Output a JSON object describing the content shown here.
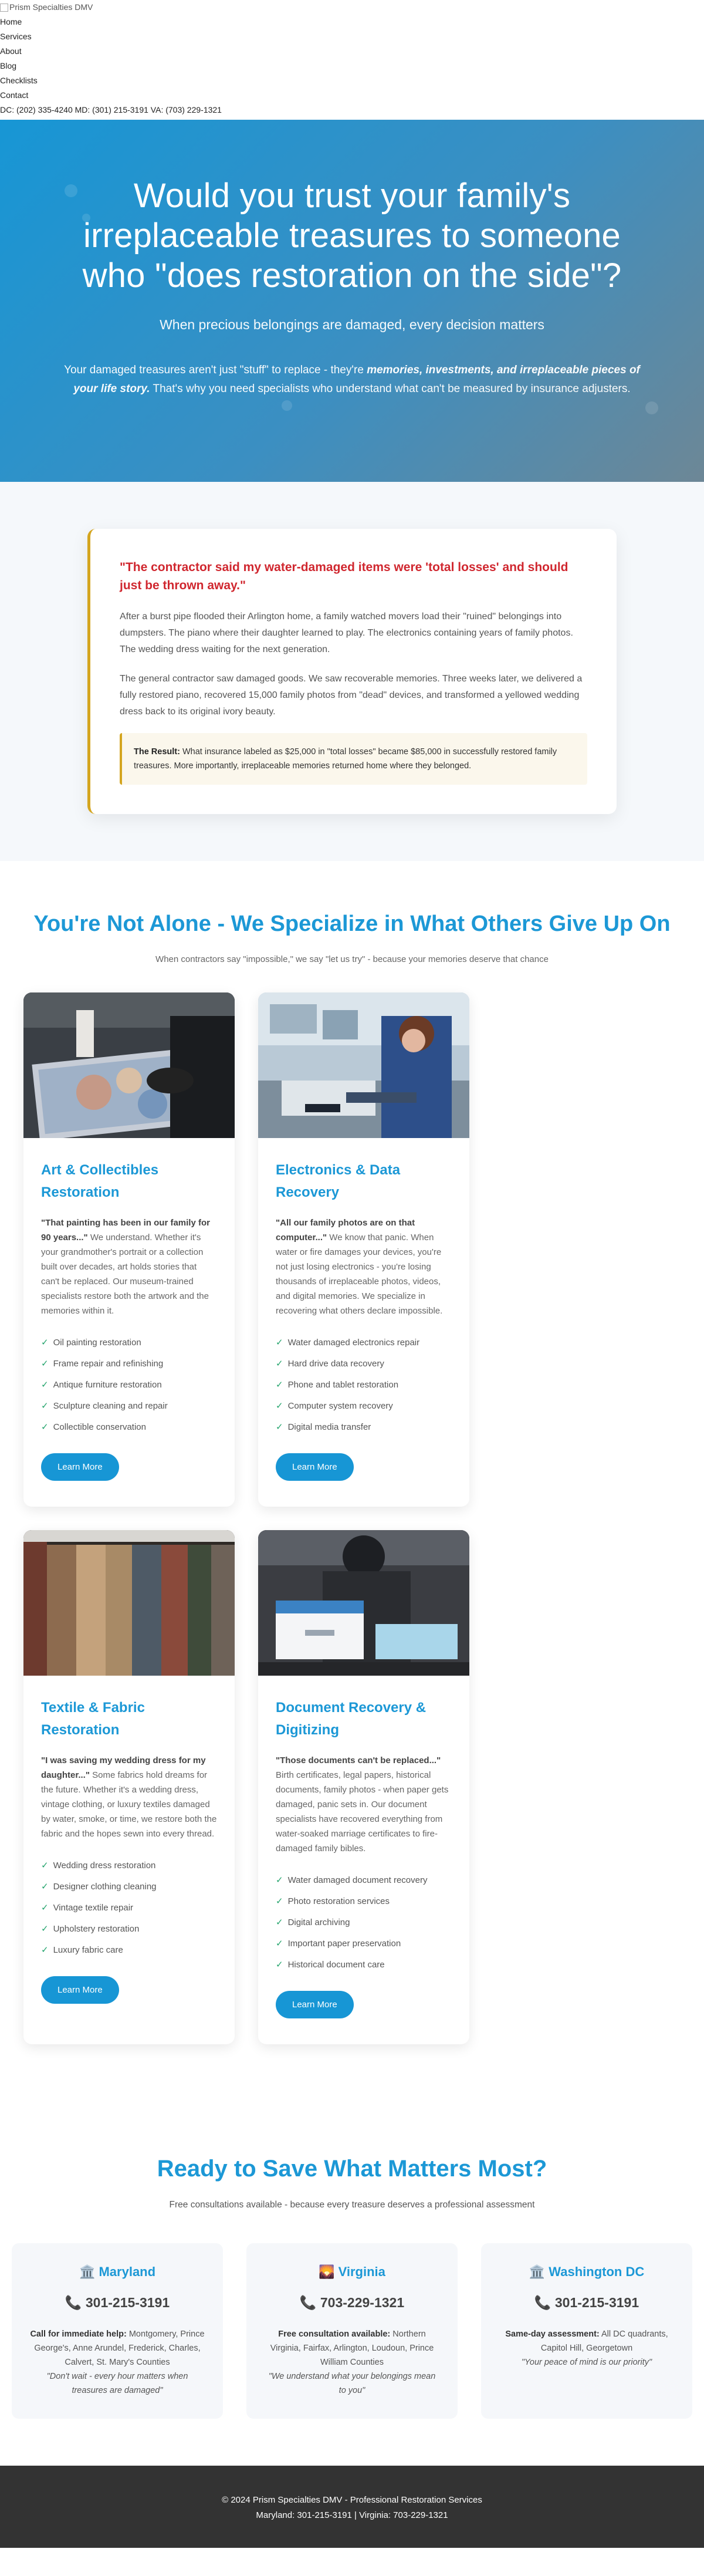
{
  "nav": {
    "logo_alt": "Prism Specialties DMV",
    "links": [
      "Home",
      "Services",
      "About",
      "Blog",
      "Checklists",
      "Contact"
    ],
    "contact_line": "DC: (202) 335-4240 MD: (301) 215-3191 VA: (703) 229-1321"
  },
  "hero": {
    "title": "Would you trust your family's irreplaceable treasures to someone who \"does restoration on the side\"?",
    "subtitle": "When precious belongings are damaged, every decision matters",
    "desc_before": "Your damaged treasures aren't just \"stuff\" to replace - they're ",
    "desc_bold": "memories, investments, and irreplaceable pieces of your life story.",
    "desc_after": " That's why you need specialists who understand what can't be measured by insurance adjusters."
  },
  "story": {
    "quote": "\"The contractor said my water-damaged items were 'total losses' and should just be thrown away.\"",
    "p1": "After a burst pipe flooded their Arlington home, a family watched movers load their \"ruined\" belongings into dumpsters. The piano where their daughter learned to play. The electronics containing years of family photos. The wedding dress waiting for the next generation.",
    "p2": "The general contractor saw damaged goods. We saw recoverable memories. Three weeks later, we delivered a fully restored piano, recovered 15,000 family photos from \"dead\" devices, and transformed a yellowed wedding dress back to its original ivory beauty.",
    "result_label": "The Result:",
    "result_text": " What insurance labeled as $25,000 in \"total losses\" became $85,000 in successfully restored family treasures. More importantly, irreplaceable memories returned home where they belonged."
  },
  "services": {
    "title": "You're Not Alone - We Specialize in What Others Give Up On",
    "tagline": "When contractors say \"impossible,\" we say \"let us try\" - because your memories deserve that chance",
    "cards": [
      {
        "title": "Art & Collectibles Restoration",
        "lead": "\"That painting has been in our family for 90 years...\"",
        "text": " We understand. Whether it's your grandmother's portrait or a collection built over decades, art holds stories that can't be replaced. Our museum-trained specialists restore both the artwork and the memories within it.",
        "items": [
          "Oil painting restoration",
          "Frame repair and refinishing",
          "Antique furniture restoration",
          "Sculpture cleaning and repair",
          "Collectible conservation"
        ],
        "button": "Learn More"
      },
      {
        "title": "Electronics & Data Recovery",
        "lead": "\"All our family photos are on that computer...\"",
        "text": " We know that panic. When water or fire damages your devices, you're not just losing electronics - you're losing thousands of irreplaceable photos, videos, and digital memories. We specialize in recovering what others declare impossible.",
        "items": [
          "Water damaged electronics repair",
          "Hard drive data recovery",
          "Phone and tablet restoration",
          "Computer system recovery",
          "Digital media transfer"
        ],
        "button": "Learn More"
      },
      {
        "title": "Textile & Fabric Restoration",
        "lead": "\"I was saving my wedding dress for my daughter...\"",
        "text": " Some fabrics hold dreams for the future. Whether it's a wedding dress, vintage clothing, or luxury textiles damaged by water, smoke, or time, we restore both the fabric and the hopes sewn into every thread.",
        "items": [
          "Wedding dress restoration",
          "Designer clothing cleaning",
          "Vintage textile repair",
          "Upholstery restoration",
          "Luxury fabric care"
        ],
        "button": "Learn More"
      },
      {
        "title": "Document Recovery & Digitizing",
        "lead": "\"Those documents can't be replaced...\"",
        "text": " Birth certificates, legal papers, historical documents, family photos - when paper gets damaged, panic sets in. Our document specialists have recovered everything from water-soaked marriage certificates to fire-damaged family bibles.",
        "items": [
          "Water damaged document recovery",
          "Photo restoration services",
          "Digital archiving",
          "Important paper preservation",
          "Historical document care"
        ],
        "button": "Learn More"
      }
    ]
  },
  "ready": {
    "title": "Ready to Save What Matters Most?",
    "tagline": "Free consultations available - because every treasure deserves a professional assessment",
    "states": [
      {
        "icon": "🏛️",
        "name": "Maryland",
        "phone": "301-215-3191",
        "note_label": "Call for immediate help:",
        "note": " Montgomery, Prince George's, Anne Arundel, Frederick, Charles, Calvert, St. Mary's Counties",
        "quote": "\"Don't wait - every hour matters when treasures are damaged\""
      },
      {
        "icon": "🌄",
        "name": "Virginia",
        "phone": "703-229-1321",
        "note_label": "Free consultation available:",
        "note": " Northern Virginia, Fairfax, Arlington, Loudoun, Prince William Counties",
        "quote": "\"We understand what your belongings mean to you\""
      },
      {
        "icon": "🏛️",
        "name": "Washington DC",
        "phone": "301-215-3191",
        "note_label": "Same-day assessment:",
        "note": " All DC quadrants, Capitol Hill, Georgetown",
        "quote": "\"Your peace of mind is our priority\""
      }
    ],
    "phone_icon": "📞"
  },
  "footer": {
    "line1": "© 2024 Prism Specialties DMV - Professional Restoration Services",
    "line2": "Maryland: 301-215-3191 | Virginia: 703-229-1321"
  },
  "colors": {
    "accent": "#1c98d6",
    "alert": "#d0272f",
    "gold": "#d4a51f",
    "check": "#21a36b",
    "footer": "#333333"
  }
}
